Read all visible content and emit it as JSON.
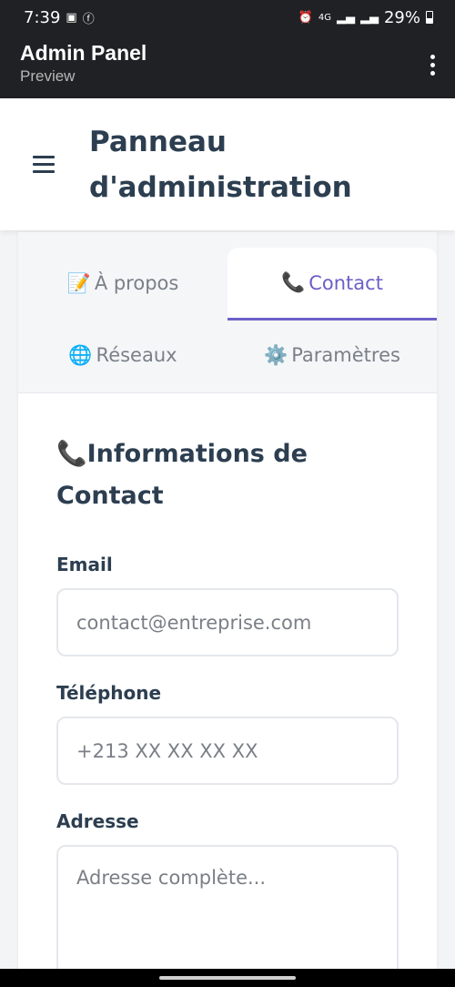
{
  "status_bar": {
    "time": "7:39",
    "battery": "29%",
    "left_icons": [
      "gallery-icon",
      "facebook-icon"
    ],
    "right_icons": [
      "alarm-icon",
      "4g-icon",
      "signal-icon",
      "signal-icon",
      "battery-icon"
    ]
  },
  "app_bar": {
    "title": "Admin Panel",
    "subtitle": "Preview"
  },
  "header": {
    "title": "Panneau d'administration"
  },
  "tabs": [
    {
      "icon": "📝",
      "label": "À propos",
      "active": false
    },
    {
      "icon": "📞",
      "label": "Contact",
      "active": true
    },
    {
      "icon": "🌐",
      "label": "Réseaux",
      "active": false
    },
    {
      "icon": "⚙️",
      "label": "Paramètres",
      "active": false
    }
  ],
  "form": {
    "section_icon": "📞",
    "section_title": "Informations de Contact",
    "email_label": "Email",
    "email_placeholder": "contact@entreprise.com",
    "email_value": "",
    "phone_label": "Téléphone",
    "phone_placeholder": "+213 XX XX XX XX",
    "phone_value": "",
    "address_label": "Adresse",
    "address_placeholder": "Adresse complète...",
    "address_value": ""
  },
  "colors": {
    "accent": "#6c5fc7",
    "heading": "#2c3e50",
    "app_bar": "#202124"
  }
}
